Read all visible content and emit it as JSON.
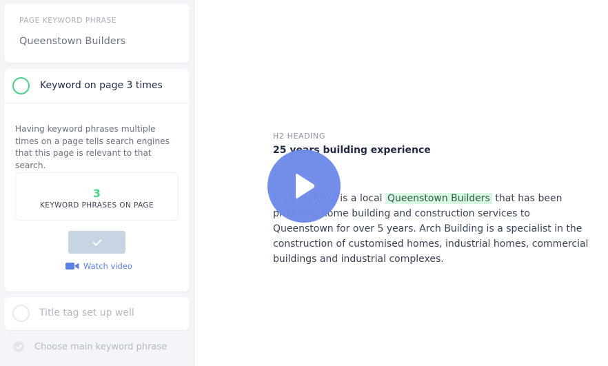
{
  "keyword": {
    "label": "PAGE KEYWORD PHRASE",
    "value": "Queenstown Builders"
  },
  "checks": [
    {
      "title": "Keyword on page 3 times",
      "status": "active",
      "description": "Having keyword phrases multiple times on a page tells search engines that this page is relevant to that search.",
      "count": "3",
      "count_label": "KEYWORD PHRASES ON PAGE",
      "confirm_icon": "check-icon",
      "watch_icon": "video-camera-icon",
      "watch_label": "Watch video"
    },
    {
      "title": "Title tag set up well",
      "status": "pending"
    },
    {
      "title": "Choose main keyword phrase",
      "status": "done"
    }
  ],
  "preview": {
    "heading_label": "H2 HEADING",
    "heading_text": "25 years building experience",
    "para_before": "Arch Building is a local ",
    "para_highlight": "Queenstown Builders",
    "para_after": " that has been providing home building and construction services to Queenstown for over 5 years. Arch Building is a specialist in the construction of customised homes, industrial homes, commercial buildings and industrial complexes.",
    "play_icon": "play-icon"
  },
  "colors": {
    "accent_green": "#4cd08a",
    "play_blue": "#6f8be8",
    "link_blue": "#5a7fe6",
    "highlight_bg": "#d9f6e4"
  }
}
